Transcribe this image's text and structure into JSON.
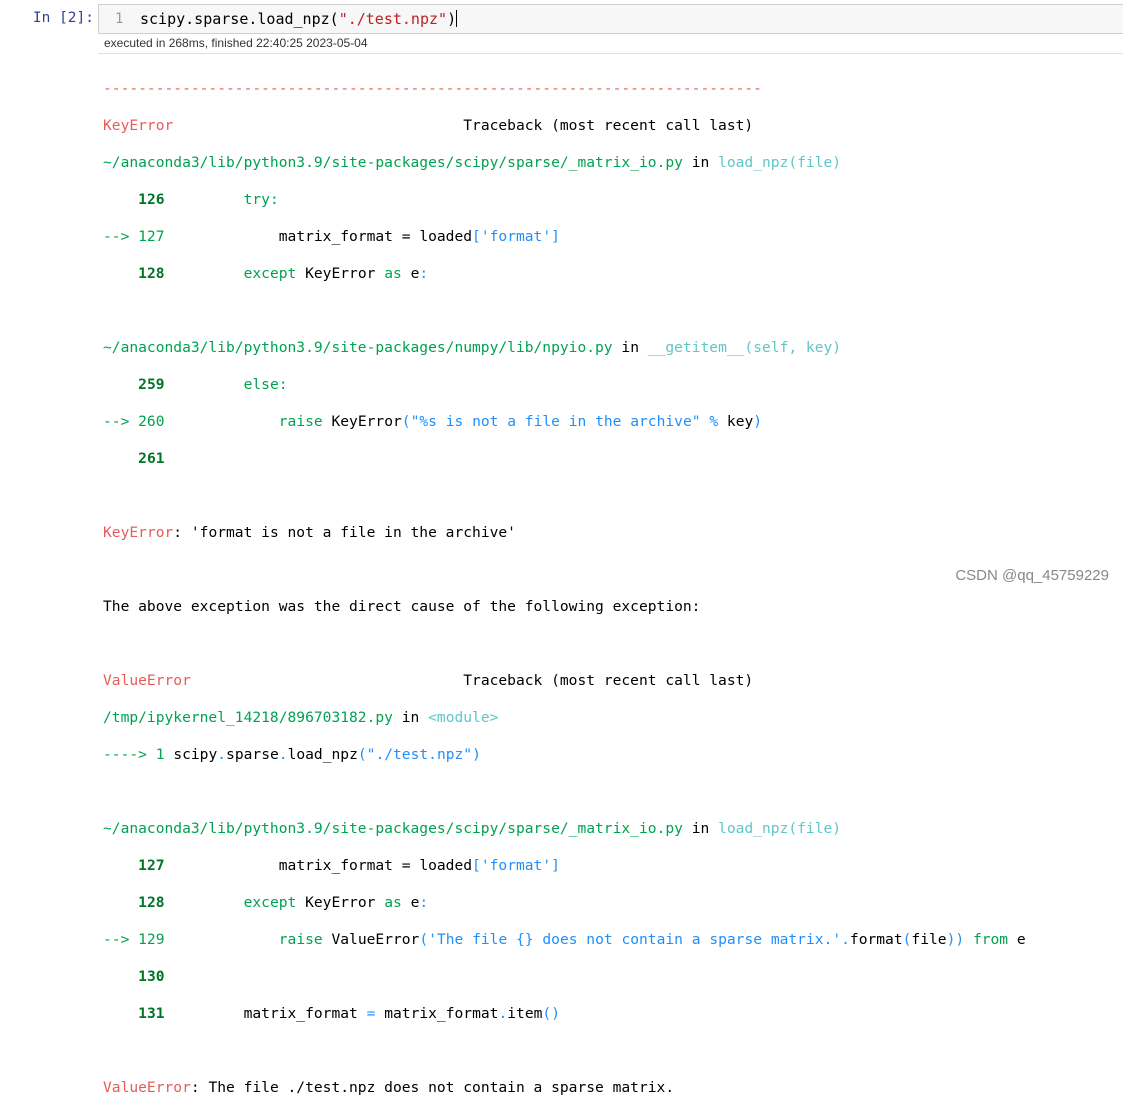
{
  "cell": {
    "prompt": "In [2]:",
    "line_number": "1",
    "code_prefix": "scipy.sparse.load_npz(",
    "code_string": "\"./test.npz\"",
    "code_suffix": ")",
    "exec_info": "executed in 268ms, finished 22:40:25 2023-05-04"
  },
  "traceback": {
    "separator": "---------------------------------------------------------------------------",
    "err1_name": "KeyError",
    "traceback_header": "Traceback (most recent call last)",
    "file1": "~/anaconda3/lib/python3.9/site-packages/scipy/sparse/_matrix_io.py",
    "in_kw": "in",
    "func1": "load_npz(file)",
    "l126_no": "126",
    "l126_code": "try:",
    "l127_arrow": "--> 127",
    "l127_code_a": "matrix_format = loaded",
    "l127_code_b": "[",
    "l127_code_c": "'format'",
    "l127_code_d": "]",
    "l128_no": "128",
    "l128_except": "except",
    "l128_name": "KeyError",
    "l128_as": "as",
    "l128_e": "e",
    "l128_colon": ":",
    "file2": "~/anaconda3/lib/python3.9/site-packages/numpy/lib/npyio.py",
    "func2": "__getitem__(self, key)",
    "l259_no": "259",
    "l259_code": "else:",
    "l260_arrow": "--> 260",
    "l260_raise": "raise",
    "l260_name": "KeyError",
    "l260_paren": "(",
    "l260_str": "\"%s is not a file in the archive\"",
    "l260_pct": "%",
    "l260_key": "key",
    "l260_close": ")",
    "l261_no": "261",
    "keyerror_msg": ": 'format is not a file in the archive'",
    "cause_msg": "The above exception was the direct cause of the following exception:",
    "err2_name": "ValueError",
    "file3": "/tmp/ipykernel_14218/896703182.py",
    "func3": "<module>",
    "l1_arrow": "----> 1",
    "l1_a": "scipy",
    "l1_dot1": ".",
    "l1_b": "sparse",
    "l1_dot2": ".",
    "l1_c": "load_npz",
    "l1_paren": "(",
    "l1_str": "\"./test.npz\"",
    "l1_close": ")",
    "file4": "~/anaconda3/lib/python3.9/site-packages/scipy/sparse/_matrix_io.py",
    "func4": "load_npz(file)",
    "m127_no": "127",
    "m128_no": "128",
    "m129_arrow": "--> 129",
    "m129_raise": "raise",
    "m129_name": "ValueError",
    "m129_paren": "(",
    "m129_str": "'The file {} does not contain a sparse matrix.'",
    "m129_dot": ".",
    "m129_format": "format",
    "m129_paren2": "(",
    "m129_file": "file",
    "m129_close": "))",
    "m129_from": "from",
    "m129_e": "e",
    "m130_no": "130",
    "m131_no": "131",
    "m131_a": "matrix_format",
    "m131_eq": "=",
    "m131_b": "matrix_format",
    "m131_dot": ".",
    "m131_c": "item",
    "m131_paren": "()",
    "valueerror_msg": ": The file ./test.npz does not contain a sparse matrix."
  },
  "watermark": "CSDN @qq_45759229",
  "colors": {
    "error_red": "#e75c58",
    "path_green": "#00a250",
    "line_no_green": "#007427",
    "func_cyan": "#60c6c8",
    "prompt_blue": "#303f9f"
  }
}
